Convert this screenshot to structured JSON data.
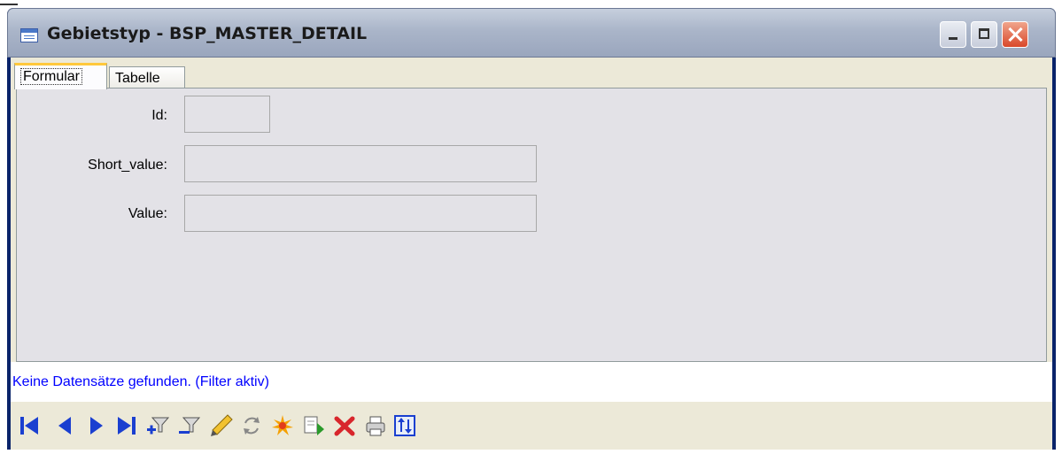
{
  "window": {
    "title": "Gebietstyp - BSP_MASTER_DETAIL"
  },
  "tabs": [
    {
      "label": "Formular",
      "active": true
    },
    {
      "label": "Tabelle",
      "active": false
    }
  ],
  "form": {
    "fields": [
      {
        "label": "Id:",
        "value": ""
      },
      {
        "label": "Short_value:",
        "value": ""
      },
      {
        "label": "Value:",
        "value": ""
      }
    ]
  },
  "status": {
    "text": "Keine Datensätze gefunden. (Filter aktiv)",
    "color": "#0000ff"
  },
  "toolbar": {
    "buttons": [
      "first-record-icon",
      "previous-record-icon",
      "next-record-icon",
      "last-record-icon",
      "filter-edit-icon",
      "filter-icon",
      "edit-pencil-icon",
      "refresh-icon",
      "new-record-icon",
      "copy-record-icon",
      "delete-icon",
      "print-icon",
      "sort-icon"
    ]
  },
  "colors": {
    "title_bar": "#aab5c9",
    "panel": "#e3e2e7",
    "toolbar_icon_blue": "#1a3fd0",
    "delete_red": "#d8262c"
  }
}
